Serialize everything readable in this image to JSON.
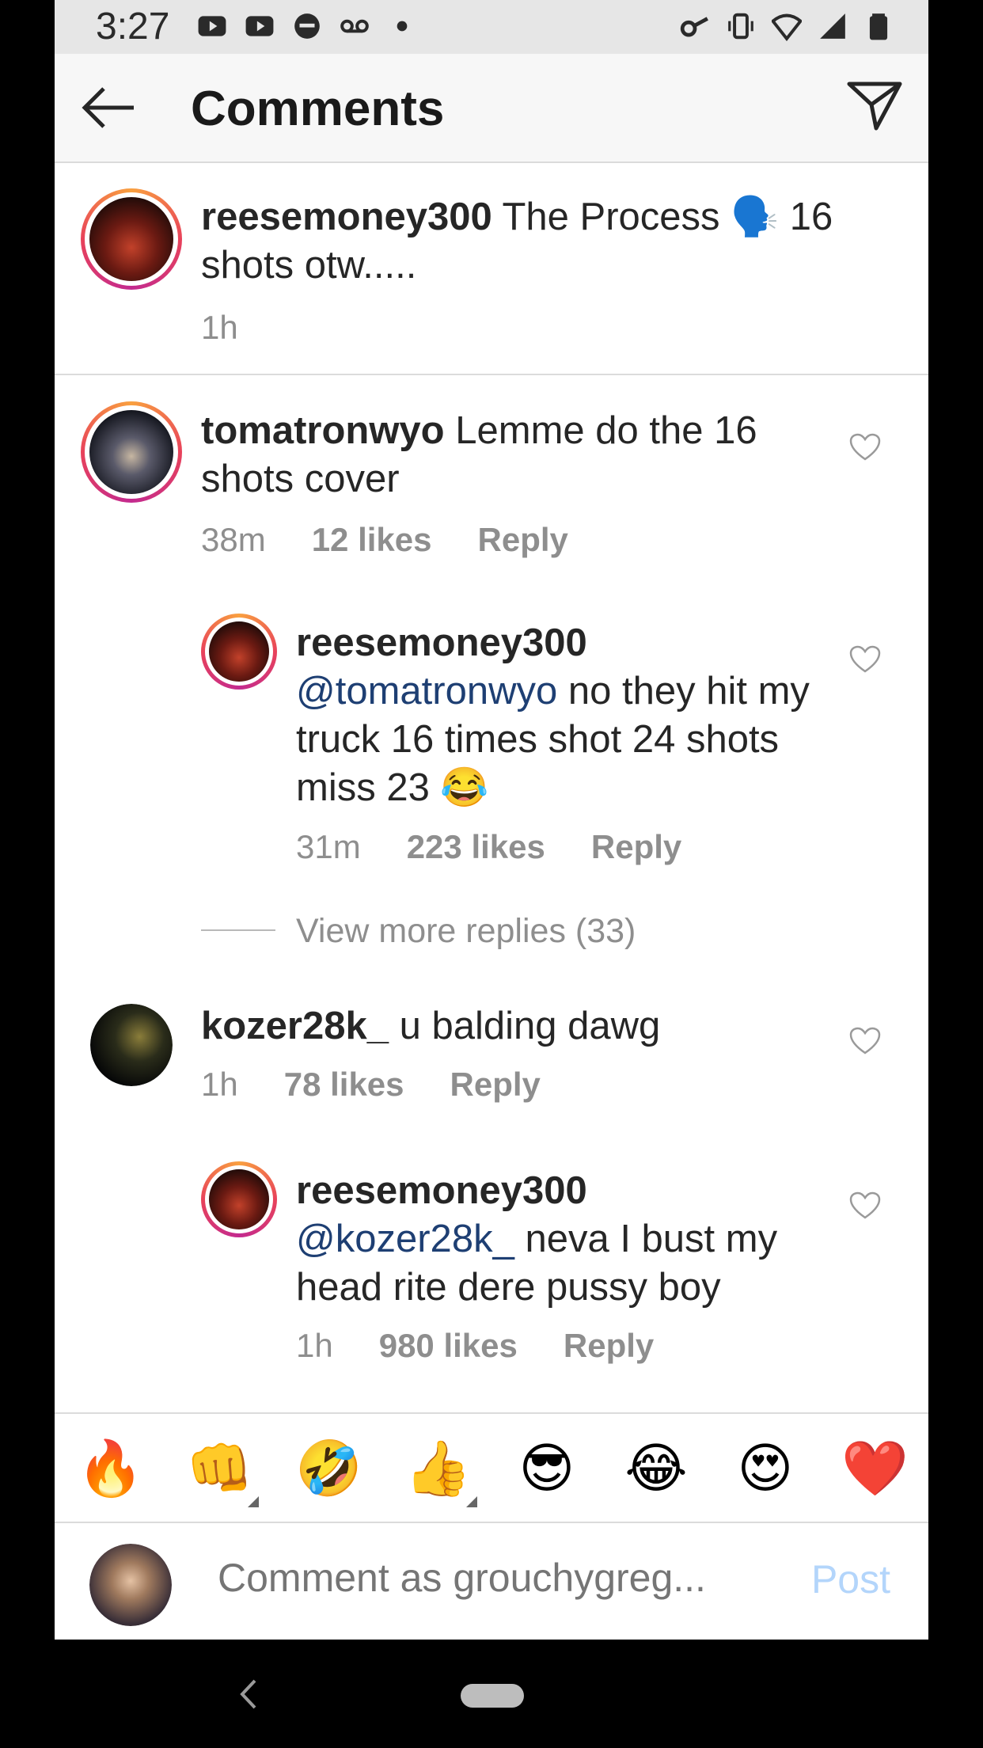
{
  "status_bar": {
    "time": "3:27"
  },
  "header": {
    "title": "Comments"
  },
  "caption": {
    "username": "reesemoney300",
    "text": "The Process 🗣️ 16 shots otw.....",
    "time": "1h"
  },
  "comments": [
    {
      "username": "tomatronwyo",
      "text": "Lemme do the 16 shots cover",
      "time": "38m",
      "likes": "12 likes",
      "reply": "Reply"
    },
    {
      "username": "reesemoney300",
      "mention": "@tomatronwyo",
      "text": "no they hit my truck 16 times shot 24 shots miss 23 😂",
      "time": "31m",
      "likes": "223 likes",
      "reply": "Reply"
    },
    {
      "username": "kozer28k_",
      "text": "u balding dawg",
      "time": "1h",
      "likes": "78 likes",
      "reply": "Reply"
    },
    {
      "username": "reesemoney300",
      "mention": "@kozer28k_",
      "text": "neva I bust my head rite dere pussy boy",
      "time": "1h",
      "likes": "980 likes",
      "reply": "Reply"
    }
  ],
  "view_more": "View more replies (33)",
  "emoji_bar": [
    "🔥",
    "👊",
    "🤣",
    "👍",
    "😎",
    "😂",
    "😍",
    "❤️"
  ],
  "composer": {
    "placeholder": "Comment as grouchygreg...",
    "post_label": "Post"
  },
  "colors": {
    "link": "#1e3f73",
    "muted": "#8e8e8e",
    "post_disabled": "#b3d5fb"
  }
}
